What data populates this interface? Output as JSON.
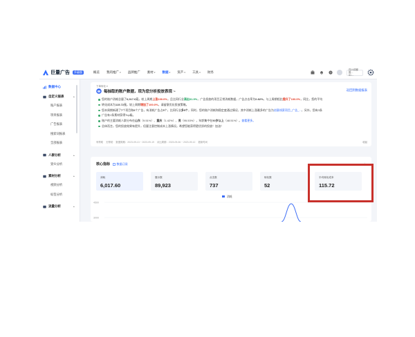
{
  "colors": {
    "accent": "#2f6bff",
    "highlight": "#c8302a",
    "up": "#e2371f",
    "down": "#15a05a",
    "line": "#3b6cf6"
  },
  "topbar": {
    "logo": "巨量广告",
    "badge": "升级版",
    "nav": [
      {
        "label": "概览",
        "active": false,
        "caret": false
      },
      {
        "label": "我的推广",
        "active": false,
        "caret": true
      },
      {
        "label": "品牌推广",
        "active": false,
        "caret": false
      },
      {
        "label": "素材",
        "active": false,
        "caret": true
      },
      {
        "label": "数据",
        "active": true,
        "caret": true
      },
      {
        "label": "资产",
        "active": false,
        "caret": true
      },
      {
        "label": "工具",
        "active": false,
        "caret": true
      },
      {
        "label": "财务",
        "active": false,
        "caret": false
      }
    ],
    "account_line1": "四川成都推...",
    "account_line2": "ID:...",
    "icons": [
      "briefcase-icon",
      "bell-icon",
      "help-icon",
      "avatar",
      "settings-icon"
    ]
  },
  "sidebar": {
    "top": "数据中心",
    "groups": [
      {
        "label": "自定义报表",
        "items": [
          "账户报表",
          "项目报表",
          "广告报表",
          "搜索词报表",
          "全部报表"
        ]
      },
      {
        "label": "人群分析",
        "items": [
          "受众分析"
        ]
      },
      {
        "label": "素材分析",
        "items": [
          "视频分析",
          "标签分析"
        ]
      },
      {
        "label": "流量分析",
        "items": []
      }
    ]
  },
  "insight": {
    "small_label": "下单转化 ▾",
    "title": "每抽取的账户数据，现为您分析投放表现 ~",
    "link": "返回到数据报表",
    "bullets": [
      {
        "parts": [
          {
            "t": "您的账户消耗总量了"
          },
          {
            "t": "6,017.6元",
            "c": "b"
          },
          {
            "t": "，较上周期"
          },
          {
            "t": "上涨100.0%",
            "c": "red"
          },
          {
            "t": "，且比同行业"
          },
          {
            "t": "高出31.9%",
            "c": "green"
          },
          {
            "t": "，广告投放的项目正常消耗数据，广告点击率为"
          },
          {
            "t": "0.82%",
            "c": "b"
          },
          {
            "t": "，与上周期相比"
          },
          {
            "t": "提升了100.0%",
            "c": "red"
          },
          {
            "t": "，同比，您的平均"
          }
        ]
      },
      {
        "parts": [
          {
            "t": "转化成本为"
          },
          {
            "t": "115.72元",
            "c": "b"
          },
          {
            "t": "，较上周期"
          },
          {
            "t": "增加了100.0%",
            "c": "red"
          },
          {
            "t": "，请留意优化投放策略。"
          }
        ]
      },
      {
        "parts": [
          {
            "t": "您本周期新建了"
          },
          {
            "t": "7",
            "c": "b"
          },
          {
            "t": "个项目和"
          },
          {
            "t": "6",
            "c": "b"
          },
          {
            "t": "个广告，有消耗广告占"
          },
          {
            "t": "5",
            "c": "b"
          },
          {
            "t": "个，比同行业"
          },
          {
            "t": "多5个",
            "c": "b"
          },
          {
            "t": "，同时，您的账户消耗和稳定度通过情况，其中消耗上涨最多的广告为"
          },
          {
            "t": "创意线索项目_广告_...",
            "c": "blue"
          },
          {
            "t": "，另外，您有3条"
          }
        ]
      },
      {
        "parts": [
          {
            "t": "广告有1条素材获得Top级。"
          }
        ]
      },
      {
        "parts": [
          {
            "t": "账户的主要消耗人群分布在"
          },
          {
            "t": "山东",
            "c": "b"
          },
          {
            "t": "（9.51%）、"
          },
          {
            "t": "重庆",
            "c": "b"
          },
          {
            "t": "（1.42%）、"
          },
          {
            "t": "男",
            "c": "b"
          },
          {
            "t": "（95.53%），年龄集中在"
          },
          {
            "t": "50岁以上",
            "c": "b"
          },
          {
            "t": "（48.51%）。"
          },
          {
            "t": "查看更多。",
            "c": "blue"
          }
        ]
      },
      {
        "parts": [
          {
            "t": "总体而言，您的投放效果有提升，但要注意控制成本上涨情况。希望您能获得更优质的投放！加油！"
          }
        ]
      }
    ],
    "footer_items": [
      "有帮助",
      "无帮助",
      "数据周期：2023-09-13 ~ 2023-09-19",
      "对比周期：2023-09-06 ~ 2023-09-12",
      "更新时间"
    ],
    "footer_right": "收起"
  },
  "metrics": {
    "title": "核心指标",
    "subtitle": "数据订阅",
    "right": "⋮",
    "cards": [
      {
        "label": "消耗",
        "value": "6,017.60"
      },
      {
        "label": "展示数",
        "value": "89,923"
      },
      {
        "label": "点击数",
        "value": "737"
      },
      {
        "label": "转化数",
        "value": "52"
      },
      {
        "label": "平均转化成本",
        "value": "115.72"
      }
    ]
  },
  "chart_data": {
    "type": "line",
    "series": [
      {
        "name": "消耗"
      }
    ],
    "y_ticks": [
      "3000",
      "4500"
    ]
  }
}
